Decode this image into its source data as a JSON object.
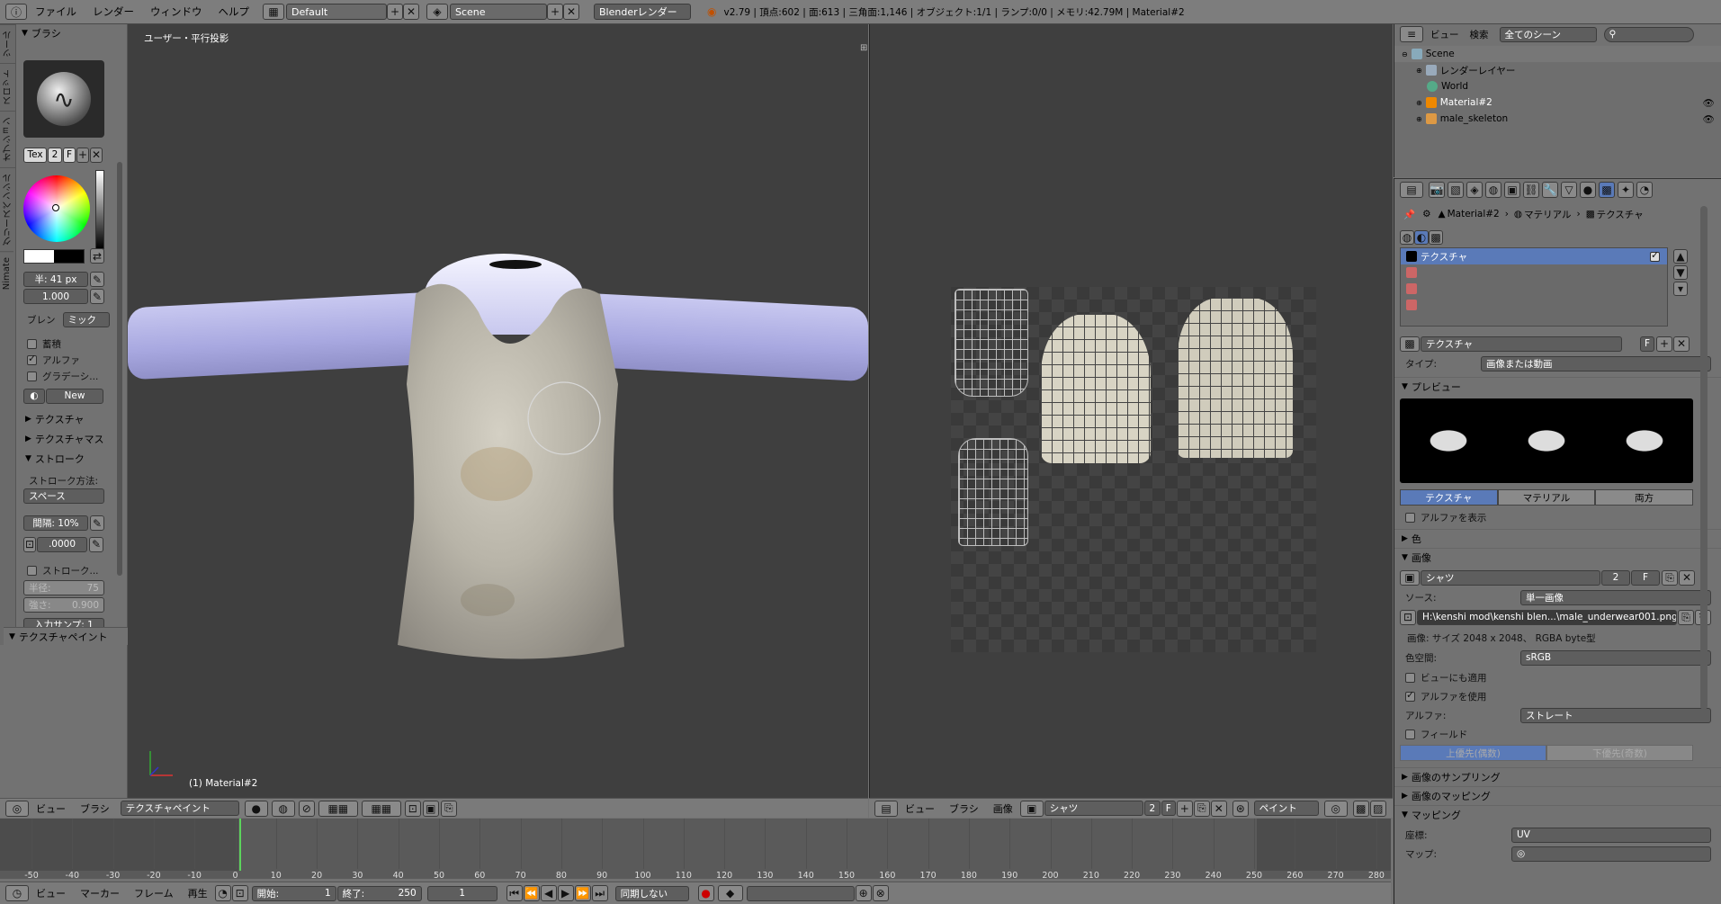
{
  "topbar": {
    "menus": [
      "ファイル",
      "レンダー",
      "ウィンドウ",
      "ヘルプ"
    ],
    "screen_layout": "Default",
    "scene": "Scene",
    "render_engine": "Blenderレンダー",
    "stats": "v2.79 | 頂点:602 | 面:613 | 三角面:1,146 | オブジェクト:1/1 | ランプ:0/0 | メモリ:42.79M | Material#2"
  },
  "left_tabs": [
    "ツール",
    "スロット",
    "オプション",
    "グリースペンシル",
    "Nimate"
  ],
  "tools": {
    "brush_header": "ブラシ",
    "tex_label": "Tex",
    "tex_num": "2",
    "tex_f": "F",
    "radius": "半: 41 px",
    "strength": "1.000",
    "blend_label": "ブレン",
    "blend_value": "ミック",
    "accumulate": "蓄積",
    "alpha": "アルファ",
    "gradient": "グラデーシ...",
    "new_btn": "New",
    "texture_sec": "テクスチャ",
    "texture_mask_sec": "テクスチャマス",
    "stroke_sec": "ストローク",
    "stroke_method_label": "ストローク方法:",
    "stroke_method": "スペース",
    "spacing": "間隔: 10%",
    "jitter": ".0000",
    "stroke_stab": "ストローク...",
    "stab_radius": "半径:",
    "stab_radius_val": "75",
    "stab_strength": "強さ:",
    "stab_strength_val": "0.900",
    "input_samples": "入力サンプ: 1",
    "texpaint_sec": "テクスチャペイント"
  },
  "viewport3d": {
    "title": "ユーザー・平行投影",
    "object_label": "(1) Material#2",
    "menus": [
      "ビュー",
      "ブラシ"
    ],
    "mode": "テクスチャペイント"
  },
  "uv_editor": {
    "menus": [
      "ビュー",
      "ブラシ",
      "画像"
    ],
    "image_name": "シャツ",
    "users": "2",
    "fake": "F",
    "mode": "ペイント"
  },
  "timeline": {
    "ticks": [
      "-50",
      "-40",
      "-30",
      "-20",
      "-10",
      "0",
      "10",
      "20",
      "30",
      "40",
      "50",
      "60",
      "70",
      "80",
      "90",
      "100",
      "110",
      "120",
      "130",
      "140",
      "150",
      "160",
      "170",
      "180",
      "190",
      "200",
      "210",
      "220",
      "230",
      "240",
      "250",
      "260",
      "270",
      "280"
    ],
    "menus": [
      "ビュー",
      "マーカー",
      "フレーム",
      "再生"
    ],
    "start": "開始:",
    "start_val": "1",
    "end": "終了:",
    "end_val": "250",
    "current": "1",
    "sync": "同期しない"
  },
  "outliner": {
    "menus": [
      "ビュー",
      "検索"
    ],
    "filter": "全てのシーン",
    "items": [
      "Scene",
      "レンダーレイヤー",
      "World",
      "Material#2",
      "male_skeleton"
    ]
  },
  "properties": {
    "breadcrumb": [
      "Material#2",
      "マテリアル",
      "テクスチャ"
    ],
    "tex_slots": [
      "テクスチャ"
    ],
    "tex_name": "テクスチャ",
    "tex_f": "F",
    "type_label": "タイプ:",
    "type_value": "画像または動画",
    "preview_sec": "プレビュー",
    "preview_tabs": [
      "テクスチャ",
      "マテリアル",
      "両方"
    ],
    "show_alpha": "アルファを表示",
    "color_sec": "色",
    "image_sec": "画像",
    "image_name": "シャツ",
    "image_users": "2",
    "image_f": "F",
    "source_label": "ソース:",
    "source_value": "単一画像",
    "filepath": "H:\\kenshi mod\\kenshi blen...\\male_underwear001.png",
    "image_info": "画像: サイズ 2048 x 2048、 RGBA byte型",
    "colorspace_label": "色空間:",
    "colorspace_value": "sRGB",
    "view_as_render": "ビューにも適用",
    "use_alpha": "アルファを使用",
    "alpha_label": "アルファ:",
    "alpha_value": "ストレート",
    "fields": "フィールド",
    "upper_first": "上優先(偶数)",
    "lower_first": "下優先(奇数)",
    "sampling_sec": "画像のサンプリング",
    "mapping_sec": "画像のマッピング",
    "mapping2_sec": "マッピング",
    "coords_label": "座標:",
    "coords_value": "UV",
    "map_label": "マップ:"
  }
}
